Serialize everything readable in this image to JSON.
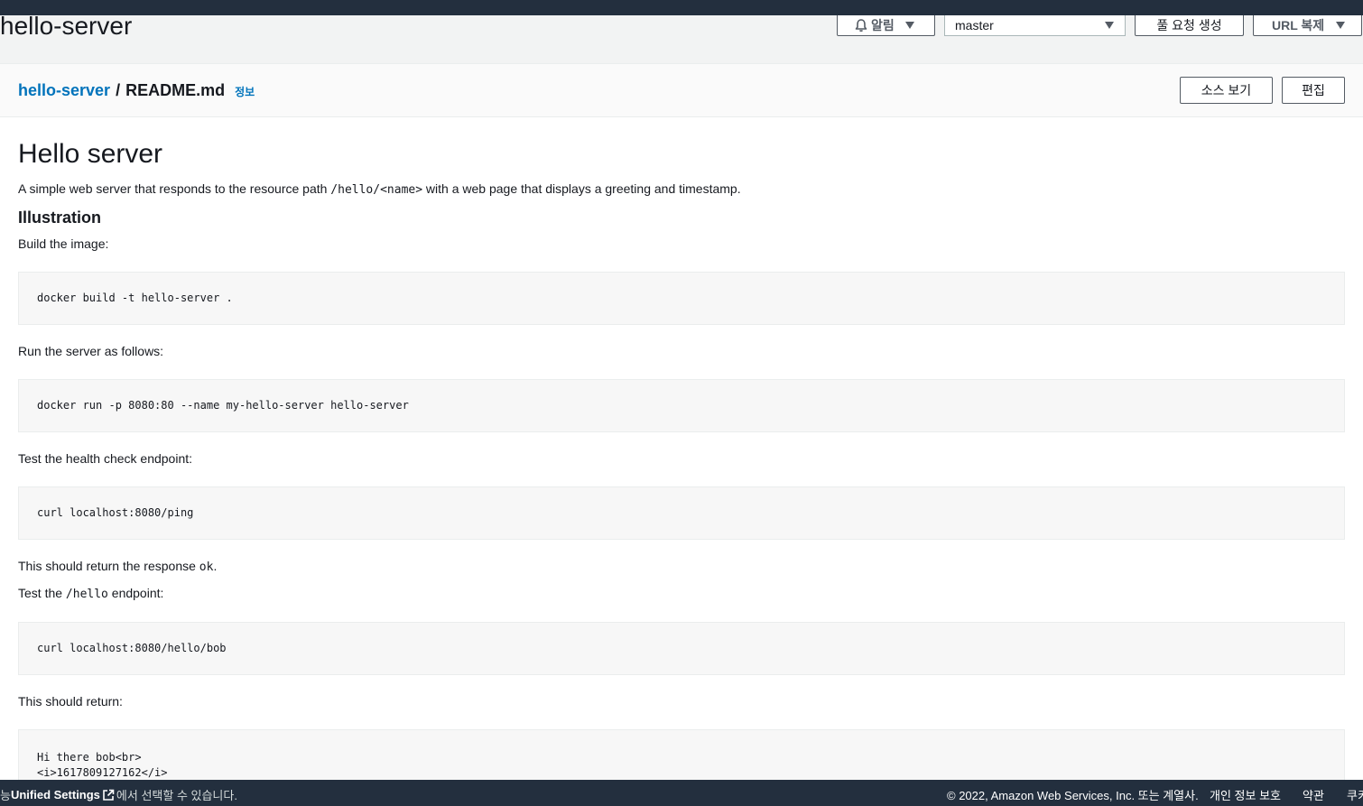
{
  "header": {
    "repo_name": "hello-server",
    "notify_label": "알림",
    "branch": "master",
    "pull_request_label": "풀 요청 생성",
    "clone_url_label": "URL 복제"
  },
  "file_bar": {
    "repo_link": "hello-server",
    "separator": "/",
    "file_name": "README.md",
    "info_link": "정보",
    "view_source_label": "소스 보기",
    "edit_label": "편집"
  },
  "readme": {
    "title": "Hello server",
    "intro_before": "A simple web server that responds to the resource path ",
    "intro_code": "/hello/<name>",
    "intro_after": " with a web page that displays a greeting and timestamp.",
    "section_title": "Illustration",
    "build_text": "Build the image:",
    "build_code": "docker build -t hello-server .",
    "run_text": "Run the server as follows:",
    "run_code": "docker run -p 8080:80 --name my-hello-server hello-server",
    "health_text": "Test the health check endpoint:",
    "health_code": "curl localhost:8080/ping",
    "ok_before": "This should return the response ",
    "ok_code": "ok",
    "ok_after": ".",
    "hello_before": "Test the ",
    "hello_code": "/hello",
    "hello_after": " endpoint:",
    "hello_curl": "curl localhost:8080/hello/bob",
    "return_text": "This should return:",
    "return_code": "Hi there bob<br>\n<i>1617809127162</i>"
  },
  "footer": {
    "left_prefix": "능",
    "unified_settings": "Unified Settings",
    "left_suffix": "에서 선택할 수 있습니다.",
    "copyright": "© 2022, Amazon Web Services, Inc. 또는 계열사.",
    "privacy": "개인 정보 보호",
    "terms": "약관",
    "cookies": "쿠키"
  }
}
